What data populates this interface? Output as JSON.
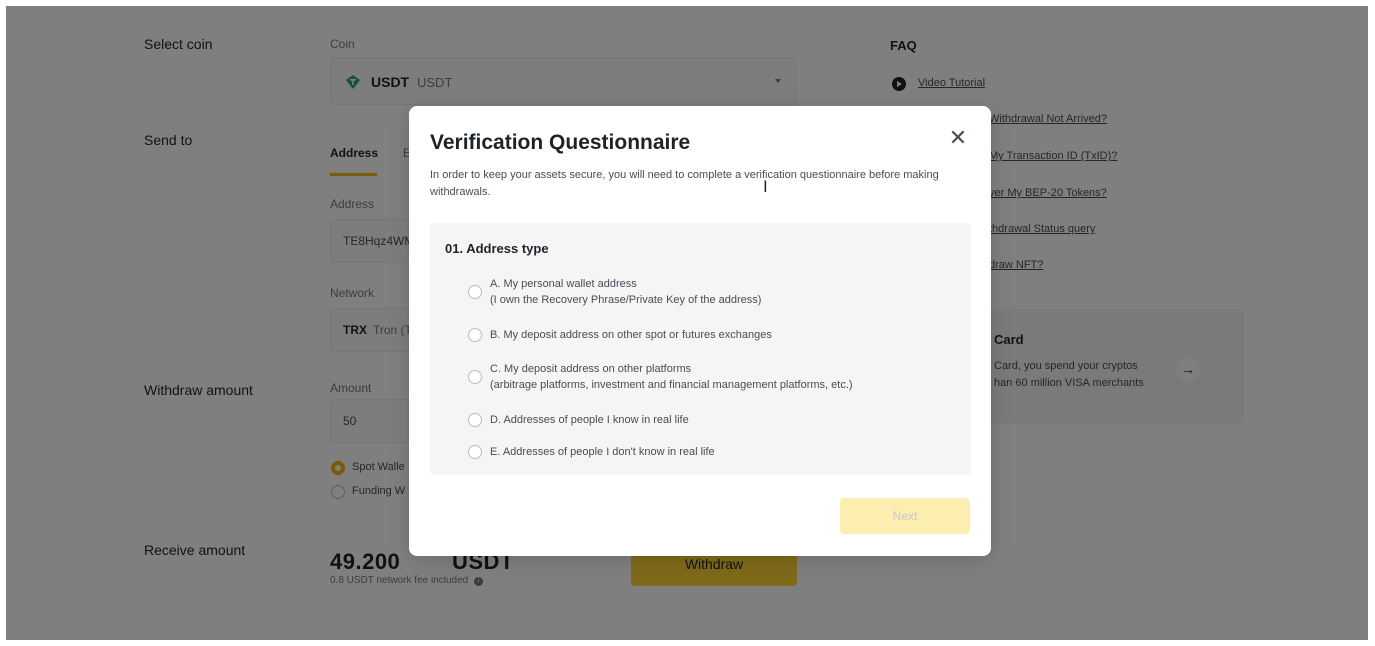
{
  "left_labels": {
    "select_coin": "Select coin",
    "send_to": "Send to",
    "withdraw_amount": "Withdraw amount",
    "receive_amount": "Receive amount"
  },
  "coin": {
    "label": "Coin",
    "code": "USDT",
    "name": "USDT"
  },
  "send_to": {
    "tab_address": "Address",
    "tab_other_partial": "E",
    "address_label": "Address",
    "address_value": "TE8Hqz4WM",
    "network_label": "Network",
    "network_code": "TRX",
    "network_name": "Tron (T"
  },
  "amount": {
    "label": "Amount",
    "value": "50",
    "wallet_spot": "Spot Walle",
    "wallet_funding": "Funding W"
  },
  "receive": {
    "amount_left": "49.200",
    "amount_right": "USDT",
    "fee_note": "0.8 USDT network fee included",
    "info_icon": "info-icon"
  },
  "withdraw_button": "Withdraw",
  "faq": {
    "title": "FAQ",
    "video_tutorial": "Video Tutorial",
    "links": [
      "Withdrawal Not Arrived?",
      "My Transaction ID (TxID)?",
      "ver My BEP-20 Tokens?",
      "thdrawal Status query",
      "draw NFT?"
    ]
  },
  "card_promo": {
    "title": "Card",
    "desc_line1": "Card, you spend your cryptos",
    "desc_line2": "han 60 million VISA merchants",
    "arrow": "→"
  },
  "modal": {
    "title": "Verification Questionnaire",
    "close": "✕",
    "description": "In order to keep your assets secure, you will need to complete a verification questionnaire before making withdrawals.",
    "question_title": "01. Address type",
    "options": [
      {
        "line1": "A. My personal wallet address",
        "line2": "(I own the Recovery Phrase/Private Key of the address)"
      },
      {
        "line1": "B. My deposit address on other spot or futures exchanges",
        "line2": ""
      },
      {
        "line1": "C. My deposit address on other platforms",
        "line2": "(arbitrage platforms, investment and financial management platforms, etc.)"
      },
      {
        "line1": "D. Addresses of people I know in real life",
        "line2": ""
      },
      {
        "line1": "E. Addresses of people I don't know in real life",
        "line2": ""
      }
    ],
    "next_button": "Next"
  },
  "colors": {
    "accent": "#fcd535",
    "radio_checked": "#f0b90b",
    "overlay": "rgba(0,0,0,0.5)"
  }
}
